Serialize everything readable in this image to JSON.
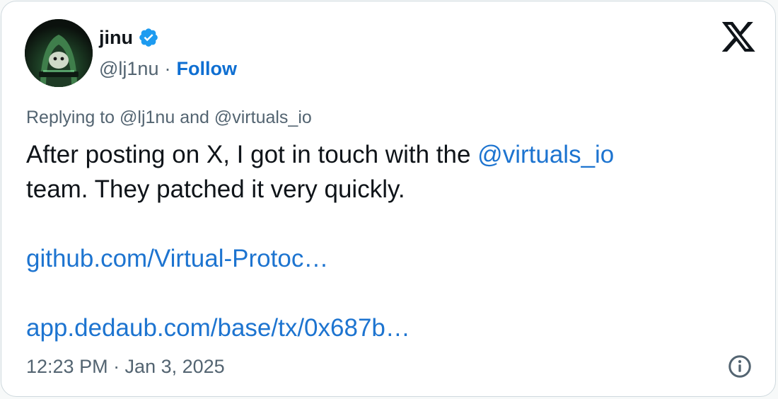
{
  "author": {
    "display_name": "jinu",
    "handle": "@lj1nu",
    "separator": "·",
    "follow_label": "Follow",
    "verified": true,
    "avatar_icon": "hooded-figure-avatar"
  },
  "brand": {
    "logo_icon": "x-logo-icon"
  },
  "reply": {
    "prefix": "Replying to",
    "mention_1": "@lj1nu",
    "conjunction": "and",
    "mention_2": "@virtuals_io"
  },
  "tweet": {
    "line1_text": "After posting on X, I got in touch with the",
    "line1_mention": "@virtuals_io",
    "line2_text": "team. They patched it very quickly.",
    "link_1": "github.com/Virtual-Protoc…",
    "link_2": "app.dedaub.com/base/tx/0x687b…"
  },
  "footer": {
    "timestamp": "12:23 PM · Jan 3, 2025",
    "info_icon": "info-icon"
  },
  "colors": {
    "accent": "#1d74d0",
    "verified_badge": "#1d9bf0",
    "text_primary": "#0f1419",
    "text_secondary": "#536471"
  }
}
